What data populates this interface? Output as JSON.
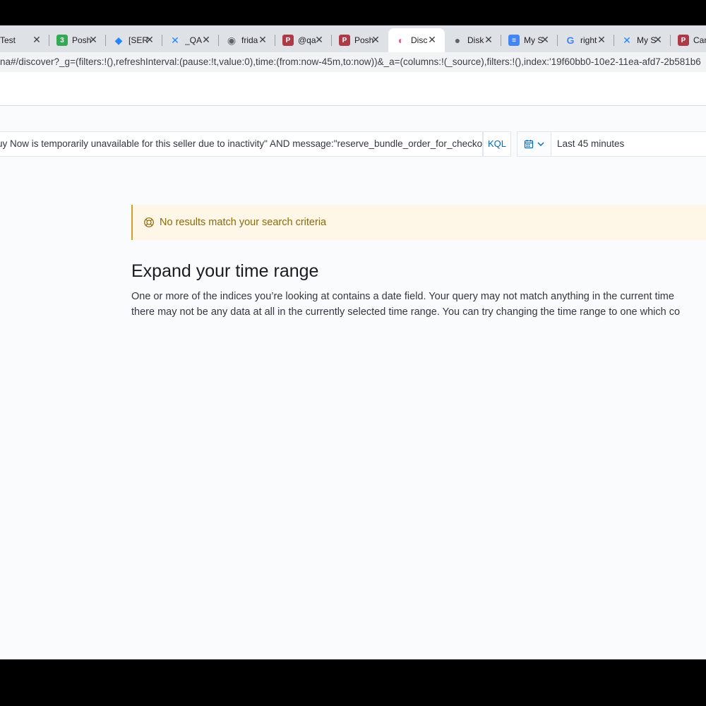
{
  "browser": {
    "tabs": [
      {
        "title": "Test",
        "icon": "document-icon",
        "color": "#5f6368"
      },
      {
        "title": "Posh",
        "icon": "calendar-icon",
        "color": "#34a853"
      },
      {
        "title": "[SER",
        "icon": "jira-icon",
        "color": "#2684ff"
      },
      {
        "title": "_QA",
        "icon": "confluence-icon",
        "color": "#2684ff"
      },
      {
        "title": "frida",
        "icon": "github-icon",
        "color": "#5f6368"
      },
      {
        "title": "@qa",
        "icon": "poshmark-icon",
        "color": "#ad3a45"
      },
      {
        "title": "Posh",
        "icon": "poshmark-icon",
        "color": "#ad3a45"
      },
      {
        "title": "Disc",
        "icon": "kibana-icon",
        "color": "#f04e98",
        "active": true
      },
      {
        "title": "Disk",
        "icon": "globe-icon",
        "color": "#5f6368"
      },
      {
        "title": "My S",
        "icon": "docs-icon",
        "color": "#4285f4"
      },
      {
        "title": "right",
        "icon": "google-icon",
        "color": "#4285f4"
      },
      {
        "title": "My S",
        "icon": "confluence-icon",
        "color": "#2684ff"
      },
      {
        "title": "Cand",
        "icon": "poshmark-icon",
        "color": "#ad3a45"
      }
    ],
    "close_glyph": "✕",
    "url": "na#/discover?_g=(filters:!(),refreshInterval:(pause:!t,value:0),time:(from:now-45m,to:now))&_a=(columns:!(_source),filters:!(),index:'19f60bb0-10e2-11ea-afd7-2b581b6"
  },
  "search": {
    "query": "uy Now is temporarily unavailable for this seller due to inactivity\" AND message:\"reserve_bundle_order_for_checko",
    "language_label": "KQL",
    "time_range": "Last 45 minutes"
  },
  "results": {
    "callout": "No results match your search criteria",
    "heading": "Expand your time range",
    "line1": "One or more of the indices you’re looking at contains a date field. Your query may not match anything in the current time",
    "line2": "there may not be any data at all in the currently selected time range. You can try changing the time range to one which co"
  },
  "colors": {
    "callout_bg": "#fef6e6",
    "callout_text": "#8a6a0a",
    "link": "#006bb4"
  }
}
